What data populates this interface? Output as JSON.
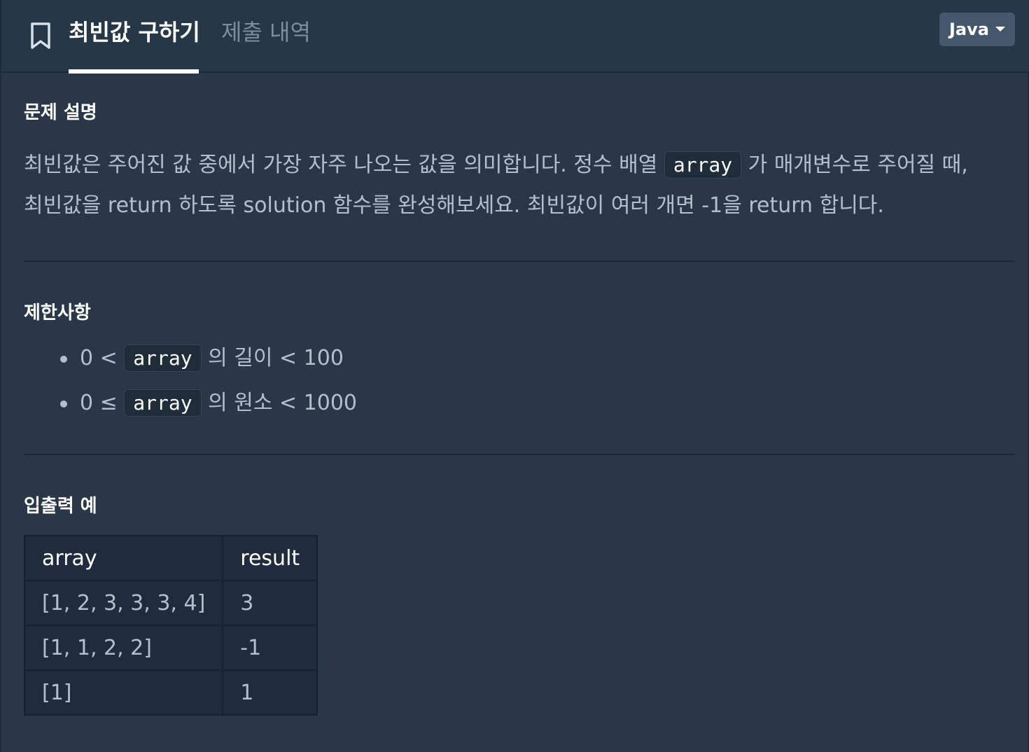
{
  "header": {
    "tab_active": "최빈값 구하기",
    "tab_inactive": "제출 내역",
    "language_button": "Java",
    "icons": {
      "bookmark": "bookmark-icon",
      "caret": "caret-down-icon"
    }
  },
  "description": {
    "title": "문제 설명",
    "line1_a": "최빈값은 주어진 값 중에서 가장 자주 나오는 값을 의미합니다. 정수 배열 ",
    "line1_code": "array",
    "line1_b": " 가 매개변수로 주어질 때,",
    "line2": "최빈값을 return 하도록 solution 함수를 완성해보세요. 최빈값이 여러 개면 -1을 return 합니다."
  },
  "constraints": {
    "title": "제한사항",
    "items": [
      {
        "pre": "0 < ",
        "code": "array",
        "post": " 의 길이 < 100"
      },
      {
        "pre": "0 ≤ ",
        "code": "array",
        "post": " 의 원소 < 1000"
      }
    ]
  },
  "examples": {
    "title": "입출력 예",
    "headers": [
      "array",
      "result"
    ],
    "rows": [
      [
        "[1, 2, 3, 3, 3, 4]",
        "3"
      ],
      [
        "[1, 1, 2, 2]",
        "-1"
      ],
      [
        "[1]",
        "1"
      ]
    ]
  },
  "colors": {
    "background": "#293749",
    "header_bg": "#263747",
    "button_bg": "#44576c",
    "table_bg": "#202b3d"
  }
}
